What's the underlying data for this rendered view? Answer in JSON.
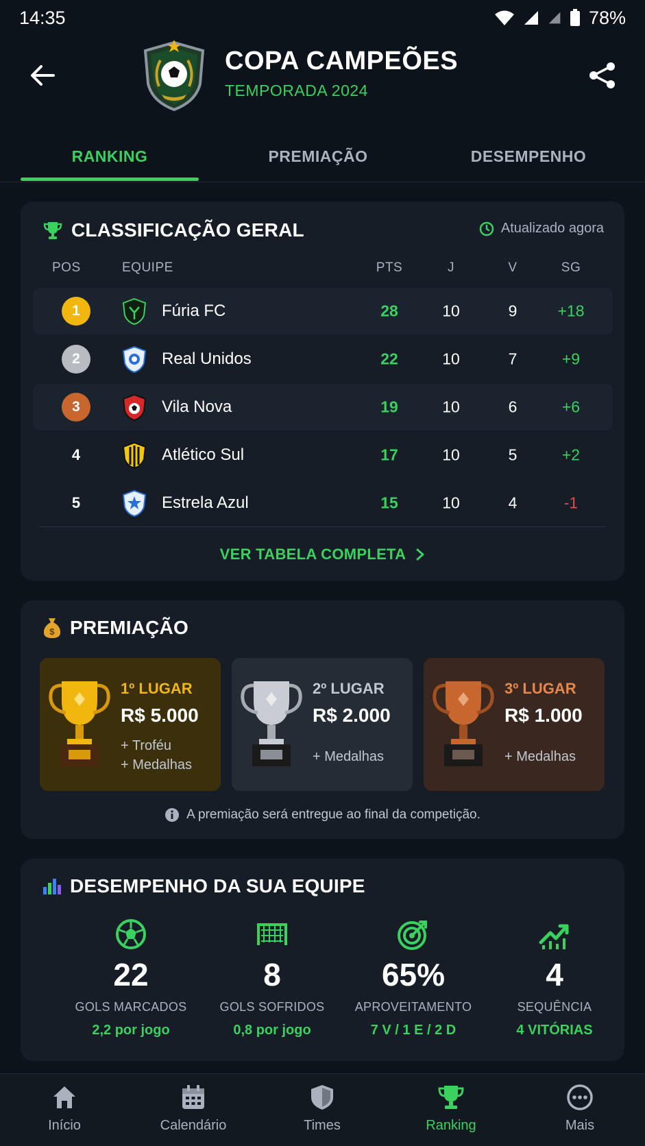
{
  "status_bar": {
    "time": "14:35",
    "battery": "78%"
  },
  "header": {
    "title": "COPA CAMPEÕES",
    "subtitle": "TEMPORADA 2024"
  },
  "tabs": [
    {
      "label": "RANKING",
      "active": true
    },
    {
      "label": "PREMIAÇÃO",
      "active": false
    },
    {
      "label": "DESEMPENHO",
      "active": false
    }
  ],
  "standings": {
    "title": "CLASSIFICAÇÃO GERAL",
    "updated": "Atualizado agora",
    "columns": {
      "pos": "POS",
      "team": "EQUIPE",
      "pts": "PTS",
      "j": "J",
      "v": "V",
      "sg": "SG"
    },
    "rows": [
      {
        "pos": "1",
        "team": "Fúria FC",
        "pts": "28",
        "j": "10",
        "v": "9",
        "sg": "+18"
      },
      {
        "pos": "2",
        "team": "Real Unidos",
        "pts": "22",
        "j": "10",
        "v": "7",
        "sg": "+9"
      },
      {
        "pos": "3",
        "team": "Vila Nova",
        "pts": "19",
        "j": "10",
        "v": "6",
        "sg": "+6"
      },
      {
        "pos": "4",
        "team": "Atlético Sul",
        "pts": "17",
        "j": "10",
        "v": "5",
        "sg": "+2"
      },
      {
        "pos": "5",
        "team": "Estrela Azul",
        "pts": "15",
        "j": "10",
        "v": "4",
        "sg": "-1"
      }
    ],
    "view_full": "VER TABELA COMPLETA"
  },
  "prizes": {
    "title": "PREMIAÇÃO",
    "items": [
      {
        "place": "1º LUGAR",
        "value": "R$ 5.000",
        "extra1": "+ Troféu",
        "extra2": "+ Medalhas"
      },
      {
        "place": "2º LUGAR",
        "value": "R$ 2.000",
        "extra1": "+ Medalhas"
      },
      {
        "place": "3º LUGAR",
        "value": "R$ 1.000",
        "extra1": "+ Medalhas"
      }
    ],
    "note": "A premiação será entregue ao final da competição."
  },
  "performance": {
    "title": "DESEMPENHO DA SUA EQUIPE",
    "stats": [
      {
        "value": "22",
        "label": "GOLS MARCADOS",
        "sub": "2,2 por jogo"
      },
      {
        "value": "8",
        "label": "GOLS SOFRIDOS",
        "sub": "0,8 por jogo"
      },
      {
        "value": "65%",
        "label": "APROVEITAMENTO",
        "sub": "7 V / 1 E / 2 D"
      },
      {
        "value": "4",
        "label": "SEQUÊNCIA",
        "sub": "4 VITÓRIAS"
      }
    ]
  },
  "bottom_nav": [
    {
      "label": "Início",
      "icon": "home-icon"
    },
    {
      "label": "Calendário",
      "icon": "calendar-icon"
    },
    {
      "label": "Times",
      "icon": "shield-icon"
    },
    {
      "label": "Ranking",
      "icon": "trophy-icon",
      "active": true
    },
    {
      "label": "Mais",
      "icon": "more-icon"
    }
  ],
  "colors": {
    "accent": "#3ad15e",
    "negative": "#e5484d",
    "gold": "#f2b70f",
    "silver": "#b8bcc2",
    "bronze": "#c8662f"
  }
}
